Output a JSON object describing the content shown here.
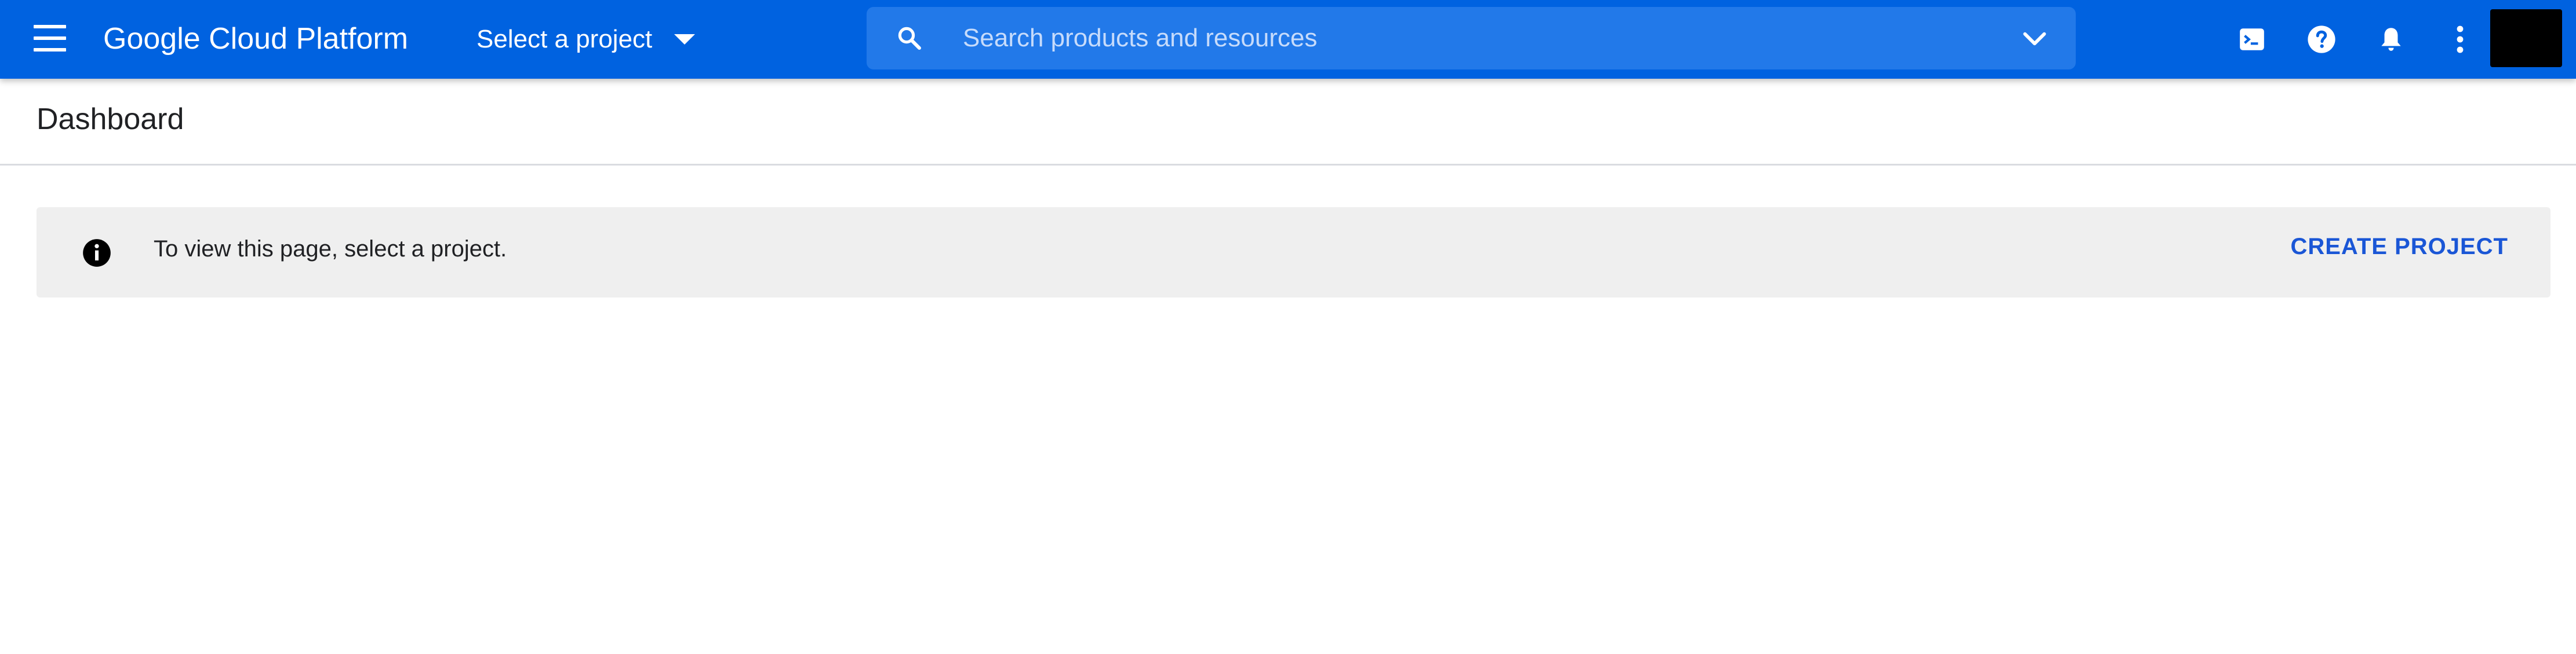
{
  "header": {
    "app_title": "Google Cloud Platform",
    "project_selector_label": "Select a project",
    "search": {
      "placeholder": "Search products and resources",
      "value": ""
    },
    "icons": [
      "menu-icon",
      "caret-down-icon",
      "search-icon",
      "chevron-down-icon",
      "cloud-shell-icon",
      "help-icon",
      "notifications-icon",
      "more-vert-icon",
      "avatar"
    ],
    "brand_color": "#0062e0",
    "search_bg_color": "#2279e9"
  },
  "page": {
    "title": "Dashboard"
  },
  "banner": {
    "message": "To view this page, select a project.",
    "action_label": "CREATE PROJECT",
    "icon": "info-icon",
    "bg_color": "#efefef",
    "action_color": "#1a56d6"
  }
}
